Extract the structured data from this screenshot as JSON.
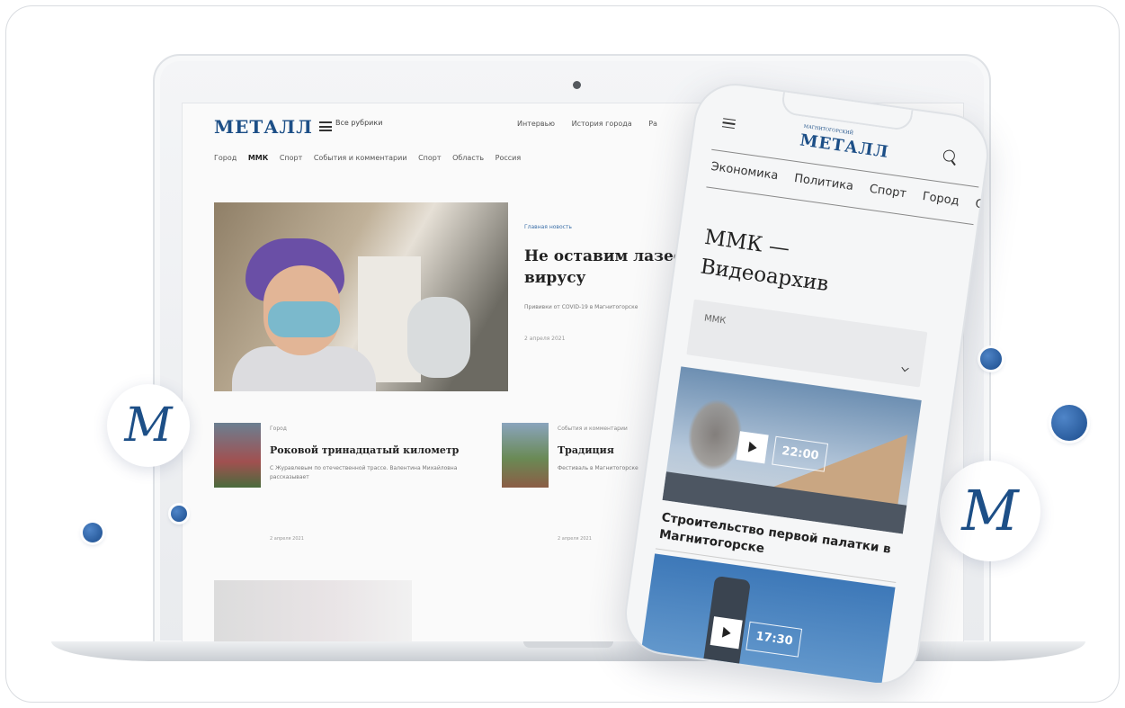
{
  "laptop_site": {
    "logo": "МЕТАЛЛ",
    "all_sections": "Все рубрики",
    "top_links": [
      "Интервью",
      "История города",
      "Ра"
    ],
    "rubrics": [
      "Город",
      "ММК",
      "Спорт",
      "События и комментарии",
      "Спорт",
      "Область",
      "Россия"
    ],
    "hero": {
      "kicker": "Главная новость",
      "title": "Не оставим лазеек вирусу",
      "lead": "Прививки от COVID-19 в Магнитогорске",
      "meta": "2 апреля 2021"
    },
    "cards": [
      {
        "kicker": "Город",
        "title": "Роковой тринадцатый километр",
        "lead": "С Журавлевым по отечественной трассе. Валентина Михайловна рассказывает",
        "meta": "2 апреля 2021"
      },
      {
        "kicker": "События и комментарии",
        "title": "Традиция",
        "lead": "Фестиваль в Магнитогорске",
        "meta": "2 апреля 2021"
      }
    ]
  },
  "phone": {
    "logo": "МЕТАЛЛ",
    "logo_small": "МАГНИТОГОРСКИЙ",
    "nav": [
      "Экономика",
      "Политика",
      "Спорт",
      "Город",
      "С"
    ],
    "page_title": "ММК — Видеоархив",
    "select_value": "ММК",
    "videos": [
      {
        "duration": "22:00",
        "title": "Строительство первой палатки в Магнитогорске"
      },
      {
        "duration": "17:30"
      }
    ]
  },
  "decor": {
    "badge_letter": "M",
    "accent_color": "#1d4f87"
  }
}
